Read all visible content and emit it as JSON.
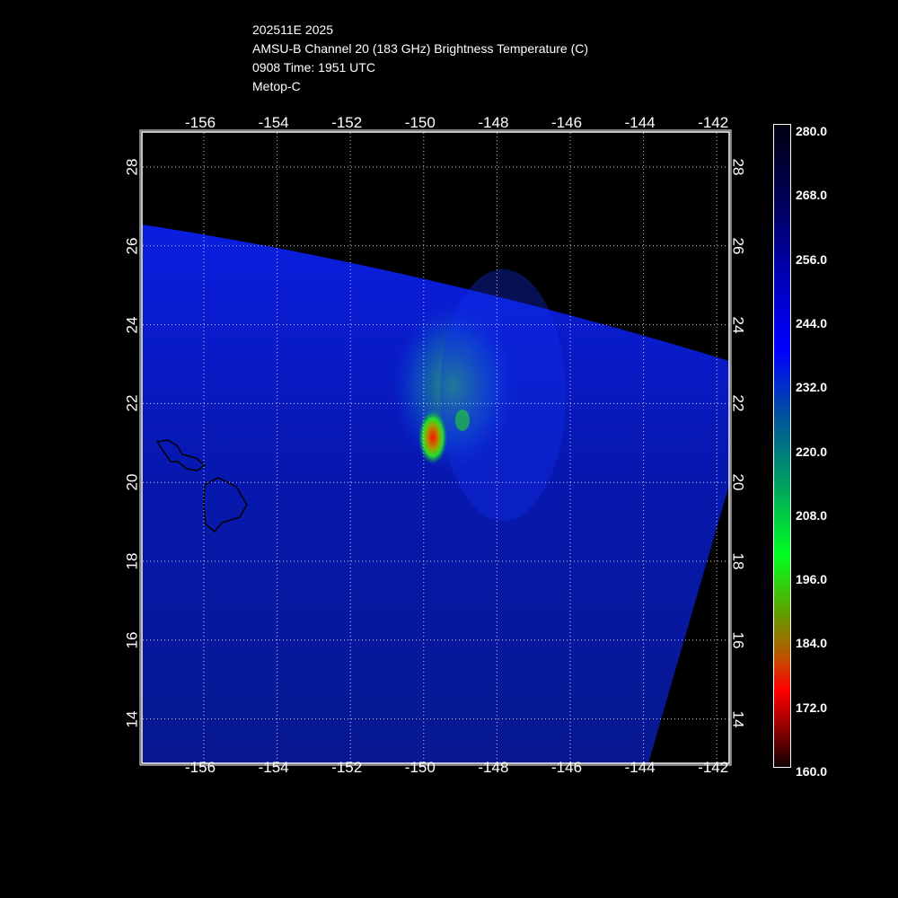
{
  "header": {
    "line1": "202511E 2025",
    "line2": "AMSU-B Channel 20 (183 GHz) Brightness Temperature (C)",
    "line3": "0908 Time: 1951 UTC",
    "line4": "Metop-C"
  },
  "chart_data": {
    "type": "heatmap",
    "title": "AMSU-B Channel 20 (183 GHz) Brightness Temperature (C)",
    "lon_ticks": [
      "-156",
      "-154",
      "-152",
      "-150",
      "-148",
      "-146",
      "-144",
      "-142"
    ],
    "lat_ticks": [
      "28",
      "26",
      "24",
      "22",
      "20",
      "18",
      "16",
      "14"
    ],
    "xlim": [
      -157.7,
      -141.7
    ],
    "ylim": [
      12.9,
      28.9
    ],
    "colorbar": {
      "labels": [
        "280.0",
        "268.0",
        "256.0",
        "244.0",
        "232.0",
        "220.0",
        "208.0",
        "196.0",
        "184.0",
        "172.0",
        "160.0"
      ],
      "range": [
        160,
        280
      ]
    },
    "features": [
      {
        "name": "coldest core",
        "lon": -149.8,
        "lat": 21.3,
        "value": 190
      },
      {
        "name": "convective ring",
        "lon": -149.5,
        "lat": 21.8,
        "value": 222
      }
    ]
  }
}
